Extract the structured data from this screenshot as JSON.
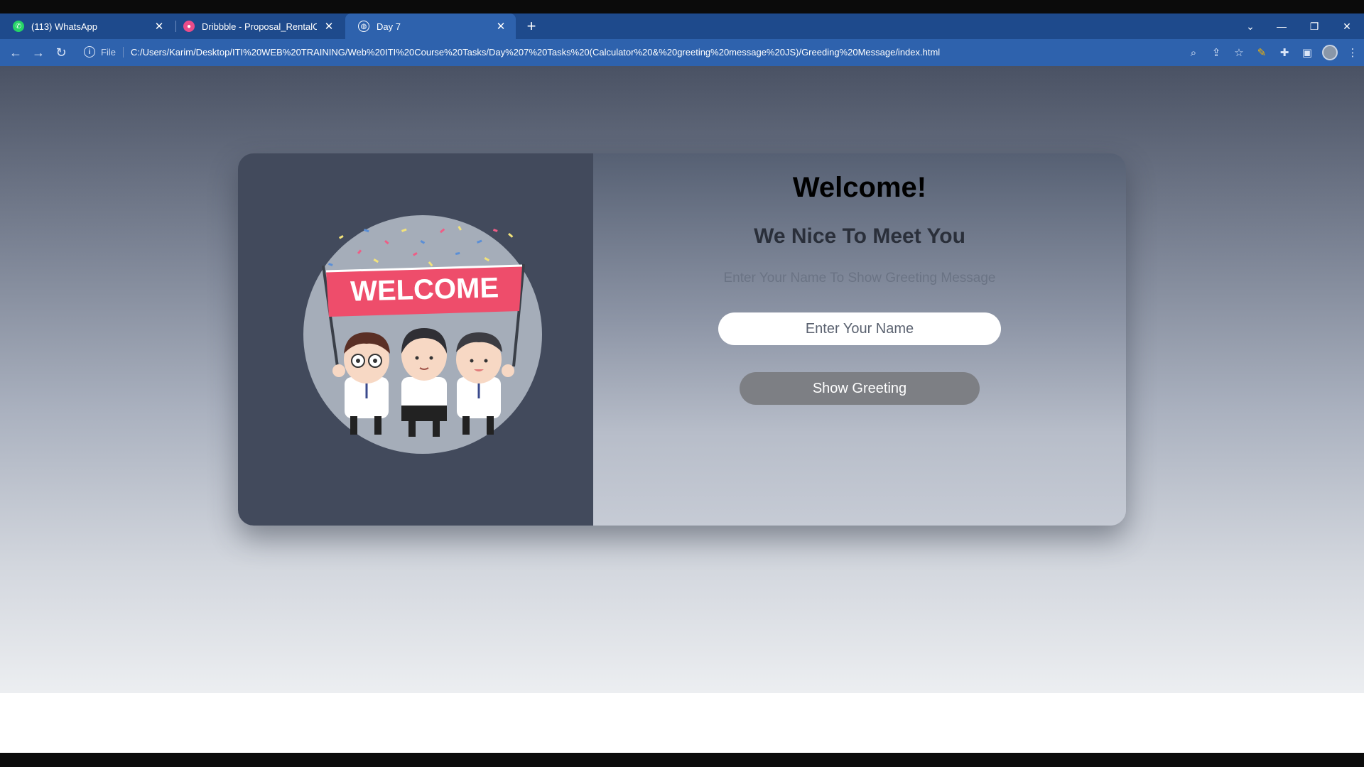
{
  "browser": {
    "tabs": [
      {
        "title": "(113) WhatsApp",
        "favicon": "whatsapp-icon",
        "color": "#25d366"
      },
      {
        "title": "Dribbble - Proposal_RentalCar.png",
        "favicon": "dribbble-icon",
        "color": "#ea4c89"
      },
      {
        "title": "Day 7",
        "favicon": "globe-icon",
        "color": "#ffffff"
      }
    ],
    "address": {
      "scheme": "File",
      "url": "C:/Users/Karim/Desktop/ITI%20WEB%20TRAINING/Web%20ITI%20Course%20Tasks/Day%207%20Tasks%20(Calculator%20&%20greeting%20message%20JS)/Greeding%20Message/index.html"
    },
    "accent": "#2e62ad"
  },
  "illustration": {
    "banner_text": "WELCOME"
  },
  "main": {
    "title": "Welcome!",
    "subtitle": "We Nice To Meet You",
    "hint": "Enter Your Name To Show Greeting Message",
    "name_placeholder": "Enter Your Name",
    "button_label": "Show Greeting"
  }
}
